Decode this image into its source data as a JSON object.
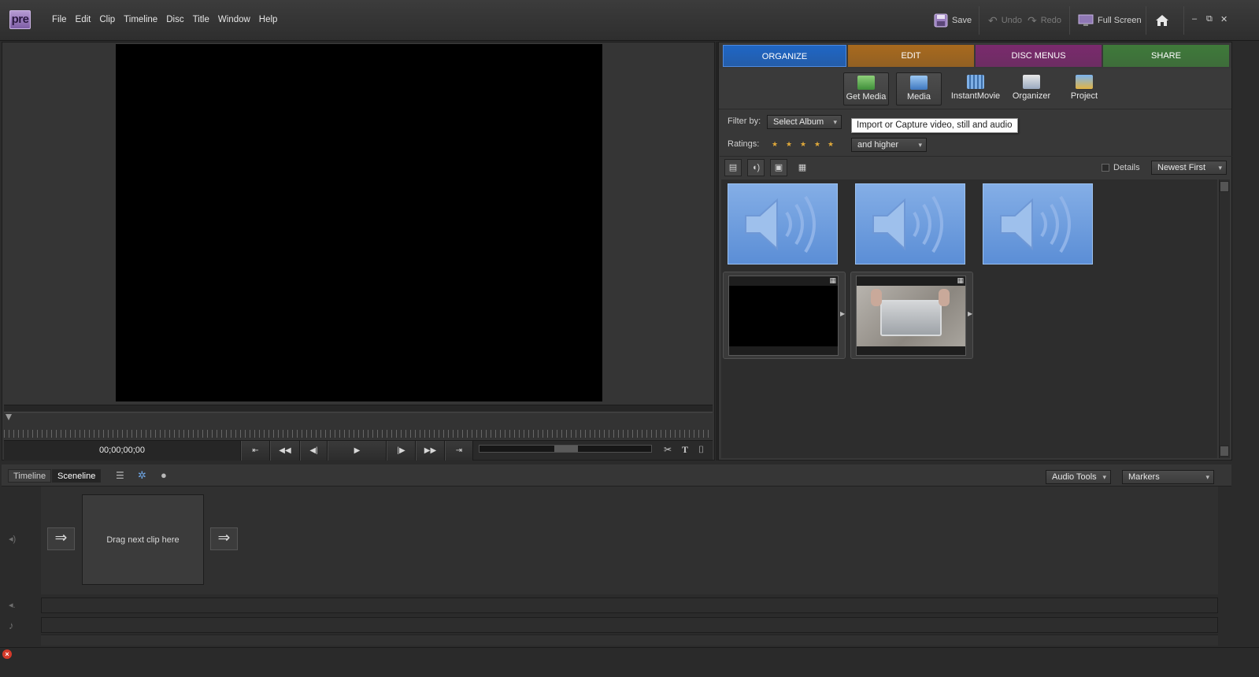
{
  "app": {
    "logo_text": "pre",
    "menus": [
      "File",
      "Edit",
      "Clip",
      "Timeline",
      "Disc",
      "Title",
      "Window",
      "Help"
    ]
  },
  "toolbar": {
    "save": "Save",
    "undo": "Undo",
    "redo": "Redo",
    "fullscreen": "Full Screen"
  },
  "monitor": {
    "timecode": "00;00;00;00"
  },
  "tabs": [
    {
      "label": "ORGANIZE",
      "color": "#1f66c5"
    },
    {
      "label": "EDIT",
      "color": "#a86a1e"
    },
    {
      "label": "DISC MENUS",
      "color": "#7a2a6d"
    },
    {
      "label": "SHARE",
      "color": "#3f7a3a"
    }
  ],
  "subtools": [
    {
      "label": "Get Media",
      "icon": "get-media-icon"
    },
    {
      "label": "Media",
      "icon": "media-icon"
    },
    {
      "label": "InstantMovie",
      "icon": "instantmovie-icon"
    },
    {
      "label": "Organizer",
      "icon": "organizer-icon"
    },
    {
      "label": "Project",
      "icon": "project-icon"
    }
  ],
  "filters": {
    "filter_label": "Filter by:",
    "album": "Select Album",
    "tooltip": "Import or Capture video, still and audio",
    "ratings_label": "Ratings:",
    "rating_stars": 5,
    "rating_mode": "and higher",
    "details_label": "Details",
    "sort": "Newest First"
  },
  "bottom": {
    "tab_timeline": "Timeline",
    "tab_sceneline": "Sceneline",
    "dropzone": "Drag next clip here",
    "audio_tools": "Audio Tools",
    "markers": "Markers"
  }
}
